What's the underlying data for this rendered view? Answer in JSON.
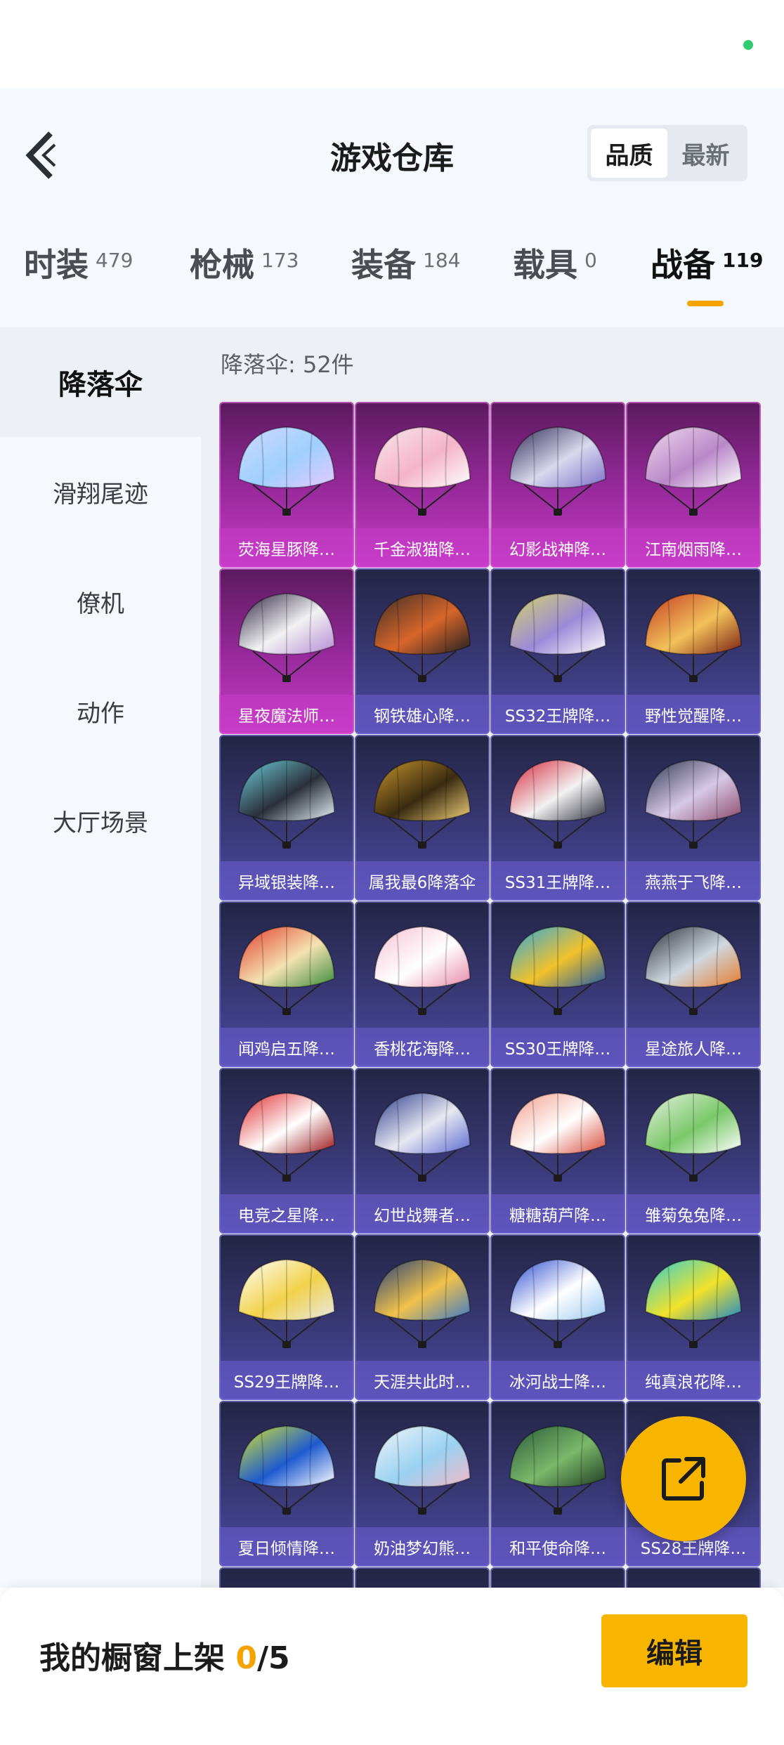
{
  "header": {
    "title": "游戏仓库",
    "sort_options": [
      "品质",
      "最新"
    ],
    "sort_active": "品质"
  },
  "tabs": [
    {
      "label": "时装",
      "count": "479"
    },
    {
      "label": "枪械",
      "count": "173"
    },
    {
      "label": "装备",
      "count": "184"
    },
    {
      "label": "载具",
      "count": "0"
    },
    {
      "label": "战备",
      "count": "119",
      "active": true
    }
  ],
  "sidebar": {
    "items": [
      {
        "label": "降落伞",
        "active": true
      },
      {
        "label": "滑翔尾迹"
      },
      {
        "label": "僚机"
      },
      {
        "label": "动作"
      },
      {
        "label": "大厅场景"
      }
    ]
  },
  "main": {
    "count_label": "降落伞: 52件",
    "items": [
      {
        "name": "荧海星豚降…",
        "rarity": "pink",
        "colors": [
          "#cfd9ff",
          "#9fd0ff",
          "#e6c8ff"
        ]
      },
      {
        "name": "千金淑猫降…",
        "rarity": "pink",
        "colors": [
          "#f7e6ec",
          "#f5b4c9",
          "#ffffff"
        ]
      },
      {
        "name": "幻影战神降…",
        "rarity": "pink",
        "colors": [
          "#2f2a55",
          "#d8d8ee",
          "#7d6fc9"
        ]
      },
      {
        "name": "江南烟雨降…",
        "rarity": "pink",
        "colors": [
          "#f2d9ee",
          "#b888c8",
          "#ffffff"
        ]
      },
      {
        "name": "星夜魔法师…",
        "rarity": "pink",
        "colors": [
          "#2a2140",
          "#f2f2f2",
          "#b58ad6"
        ]
      },
      {
        "name": "钢铁雄心降…",
        "rarity": "purple",
        "colors": [
          "#3a2c27",
          "#d8662a",
          "#1e1e22"
        ]
      },
      {
        "name": "SS32王牌降…",
        "rarity": "purple",
        "colors": [
          "#d6d66a",
          "#9a8ad8",
          "#ffffff"
        ]
      },
      {
        "name": "野性觉醒降…",
        "rarity": "purple",
        "colors": [
          "#c23a22",
          "#f2c15a",
          "#7a1e12"
        ]
      },
      {
        "name": "异域银装降…",
        "rarity": "purple",
        "colors": [
          "#6fd2e0",
          "#2a2f3a",
          "#e8f4f8"
        ]
      },
      {
        "name": "属我最6降落伞",
        "rarity": "purple",
        "colors": [
          "#c9962e",
          "#3a2a10",
          "#f0d07a"
        ]
      },
      {
        "name": "SS31王牌降…",
        "rarity": "purple",
        "colors": [
          "#d8263a",
          "#f2f2f2",
          "#2a2a3a"
        ]
      },
      {
        "name": "燕燕于飞降…",
        "rarity": "purple",
        "colors": [
          "#2a3550",
          "#d8c8e8",
          "#8a4a6a"
        ]
      },
      {
        "name": "闻鸡启五降…",
        "rarity": "purple",
        "colors": [
          "#e23a2a",
          "#f4e2b0",
          "#3a8a3a"
        ]
      },
      {
        "name": "香桃花海降…",
        "rarity": "purple",
        "colors": [
          "#f6c2d2",
          "#ffffff",
          "#e88aa8"
        ]
      },
      {
        "name": "SS30王牌降…",
        "rarity": "purple",
        "colors": [
          "#2aa8e0",
          "#f2c22a",
          "#1e5aa8"
        ]
      },
      {
        "name": "星途旅人降…",
        "rarity": "purple",
        "colors": [
          "#2a2e3a",
          "#cfd8e0",
          "#e87a2a"
        ]
      },
      {
        "name": "电竞之星降…",
        "rarity": "purple",
        "colors": [
          "#e0262a",
          "#ffffff",
          "#9a1418"
        ]
      },
      {
        "name": "幻世战舞者…",
        "rarity": "purple",
        "colors": [
          "#2a3a8a",
          "#e8e8f2",
          "#5a6ad0"
        ]
      },
      {
        "name": "糖糖葫芦降…",
        "rarity": "purple",
        "colors": [
          "#f29a8a",
          "#ffffff",
          "#d84a3a"
        ]
      },
      {
        "name": "雏菊兔兔降…",
        "rarity": "purple",
        "colors": [
          "#e8f2e0",
          "#7ac86a",
          "#ffffff"
        ]
      },
      {
        "name": "SS29王牌降…",
        "rarity": "purple",
        "colors": [
          "#ffffff",
          "#f2d24a",
          "#e8e8e8"
        ]
      },
      {
        "name": "天涯共此时…",
        "rarity": "purple",
        "colors": [
          "#1e3a7a",
          "#f2c24a",
          "#3a7ac8"
        ]
      },
      {
        "name": "冰河战士降…",
        "rarity": "purple",
        "colors": [
          "#2a4ad0",
          "#ffffff",
          "#9ac8f2"
        ]
      },
      {
        "name": "纯真浪花降…",
        "rarity": "purple",
        "colors": [
          "#2ad0d8",
          "#f2e22a",
          "#1e8ac8"
        ]
      },
      {
        "name": "夏日倾情降…",
        "rarity": "purple",
        "colors": [
          "#d8e82a",
          "#1e5ad0",
          "#ffffff"
        ]
      },
      {
        "name": "奶油梦幻熊…",
        "rarity": "purple",
        "colors": [
          "#f2f4f8",
          "#9ad2f2",
          "#f2b8c8"
        ]
      },
      {
        "name": "和平使命降…",
        "rarity": "purple",
        "colors": [
          "#2a5a3a",
          "#7ab86a",
          "#1e3a22"
        ]
      },
      {
        "name": "SS28王牌降…",
        "rarity": "purple",
        "colors": [
          "#f2f2f2",
          "#d0d0e0",
          "#9a9ac8"
        ]
      }
    ]
  },
  "bottom": {
    "prefix": "我的橱窗上架 ",
    "shelf_count": "0",
    "shelf_total": "/5",
    "edit_label": "编辑"
  },
  "theme": {
    "accent": "#f8b500",
    "rarity_pink": "#c63dc6",
    "rarity_purple": "#4d49a4"
  }
}
